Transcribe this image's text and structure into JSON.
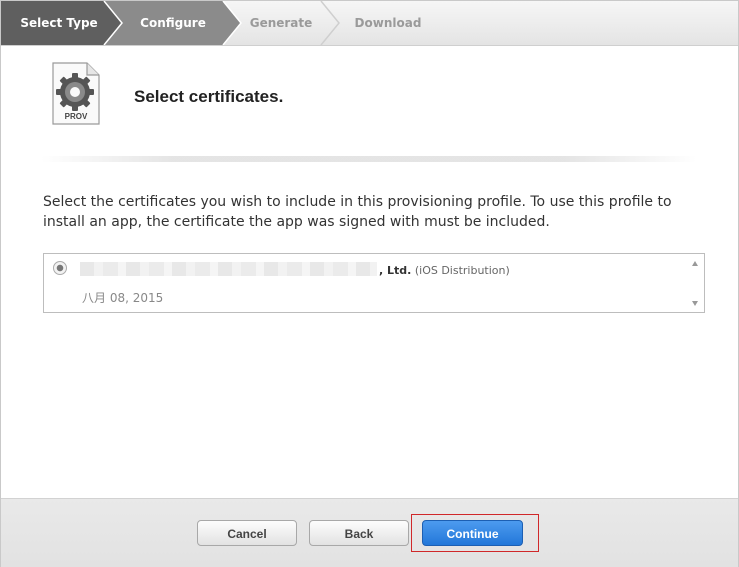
{
  "steps": {
    "items": [
      {
        "label": "Select Type",
        "state": "done"
      },
      {
        "label": "Configure",
        "state": "current"
      },
      {
        "label": "Generate",
        "state": "pending"
      },
      {
        "label": "Download",
        "state": "pending"
      }
    ]
  },
  "header": {
    "icon_label": "PROV",
    "title": "Select certificates."
  },
  "instructions": "Select the certificates you wish to include in this provisioning profile. To use this profile to install an app, the certificate the app was signed with must be included.",
  "certificates": [
    {
      "name_suffix": ", Ltd.",
      "type": "(iOS Distribution)",
      "date": "八月 08, 2015",
      "selected": true
    }
  ],
  "footer": {
    "cancel_label": "Cancel",
    "back_label": "Back",
    "continue_label": "Continue"
  },
  "colors": {
    "step_done": "#5f5f5f",
    "step_current": "#8b8b8b",
    "primary_button": "#2a80e0",
    "highlight": "#d0282a"
  }
}
